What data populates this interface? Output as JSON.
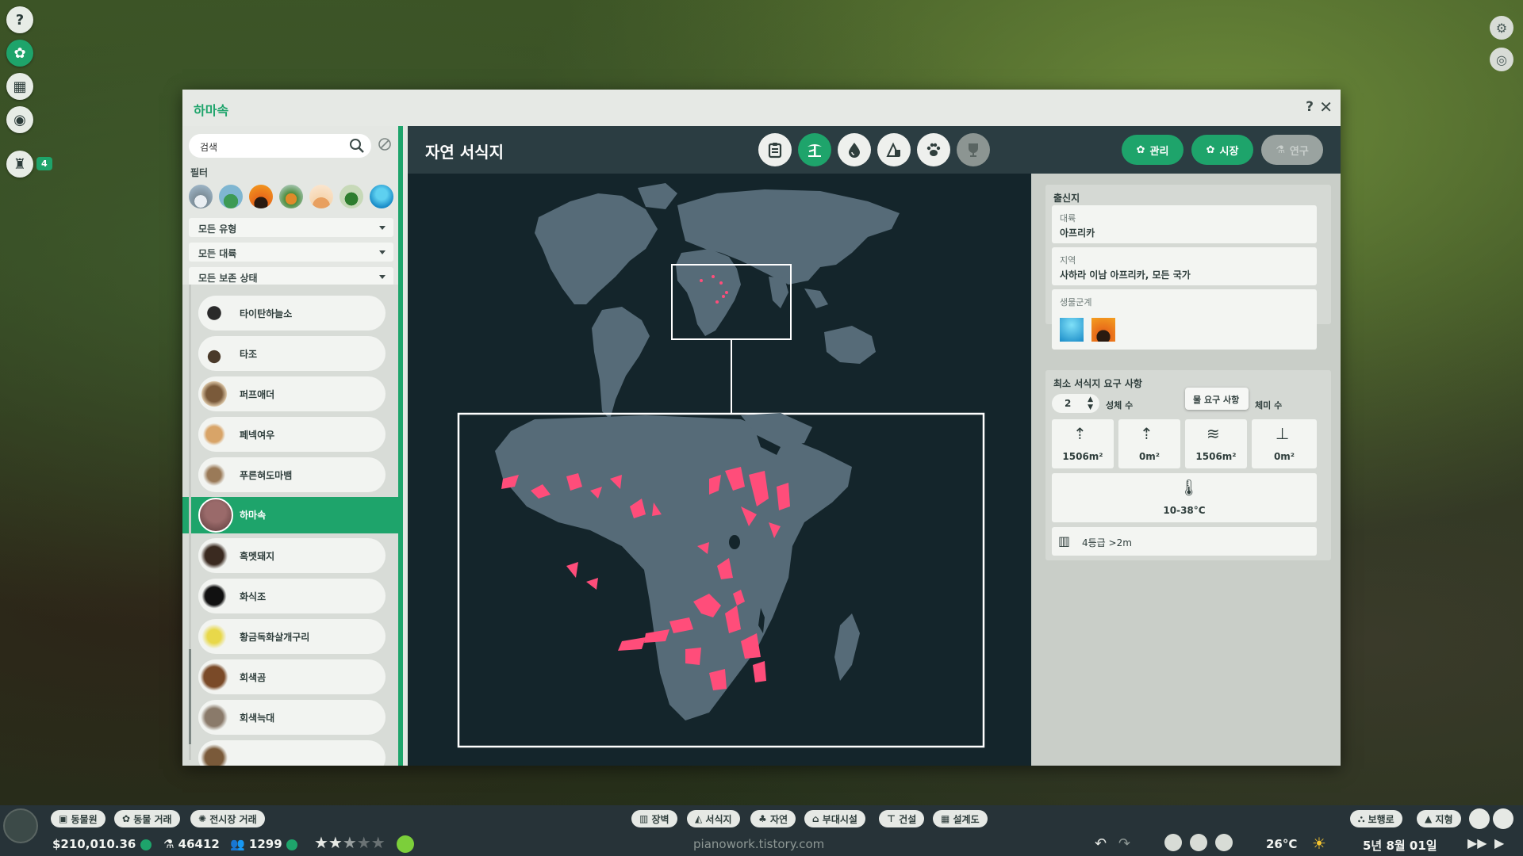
{
  "hud": {
    "notification_count": "4"
  },
  "window": {
    "title": "하마속",
    "help": "?",
    "close": "✕"
  },
  "filters": {
    "search_placeholder": "검색",
    "label": "필터",
    "biomes": [
      "tundra",
      "grassland",
      "savanna-sunset",
      "temperate-forest",
      "desert",
      "tropical",
      "aquatic"
    ],
    "dropdowns": [
      "모든 유형",
      "모든 대륙",
      "모든 보존 상태"
    ]
  },
  "animal_list": [
    {
      "name": "타이탄하늘소"
    },
    {
      "name": "타조"
    },
    {
      "name": "퍼프애더"
    },
    {
      "name": "페넥여우"
    },
    {
      "name": "푸른혀도마뱀"
    },
    {
      "name": "하마속",
      "selected": true
    },
    {
      "name": "혹멧돼지"
    },
    {
      "name": "화식조"
    },
    {
      "name": "황금독화살개구리"
    },
    {
      "name": "회색곰"
    },
    {
      "name": "회색늑대"
    }
  ],
  "main": {
    "title": "자연 서식지",
    "tabs": [
      "info-icon",
      "habitat-icon",
      "water-icon",
      "enrichment-icon",
      "welfare-icon",
      "trophy-icon"
    ],
    "buttons": {
      "manage": "관리",
      "market": "시장",
      "research": "연구"
    }
  },
  "origin": {
    "header": "출신지",
    "continent_label": "대륙",
    "continent_value": "아프리카",
    "region_label": "지역",
    "region_value": "사하라 이남 아프리카, 모든 국가",
    "biome_label": "생물군계"
  },
  "requirements": {
    "header": "최소 서식지 요구 사항",
    "count_value": "2",
    "count_label": "성체 수",
    "tooltip": "물 요구 사항",
    "partial_label": "체미 수",
    "land": "1506m²",
    "climbing": "0m²",
    "water": "1506m²",
    "deep_water": "0m²",
    "temperature": "10-38°C",
    "barrier": "4등급 >2m"
  },
  "bottom_bar": {
    "buttons": [
      "동물원",
      "동물 거래",
      "전시장 거래"
    ],
    "center_buttons": [
      "장벽",
      "서식지",
      "자연",
      "부대시설",
      "건설",
      "설계도"
    ],
    "right_buttons": [
      "보행로",
      "지형"
    ],
    "money": "$210,010.36",
    "research": "46412",
    "guests": "1299",
    "rating": 2.5,
    "watermark": "pianowork.tistory.com",
    "temperature": "26°C",
    "date": "5년 8월 01일"
  }
}
